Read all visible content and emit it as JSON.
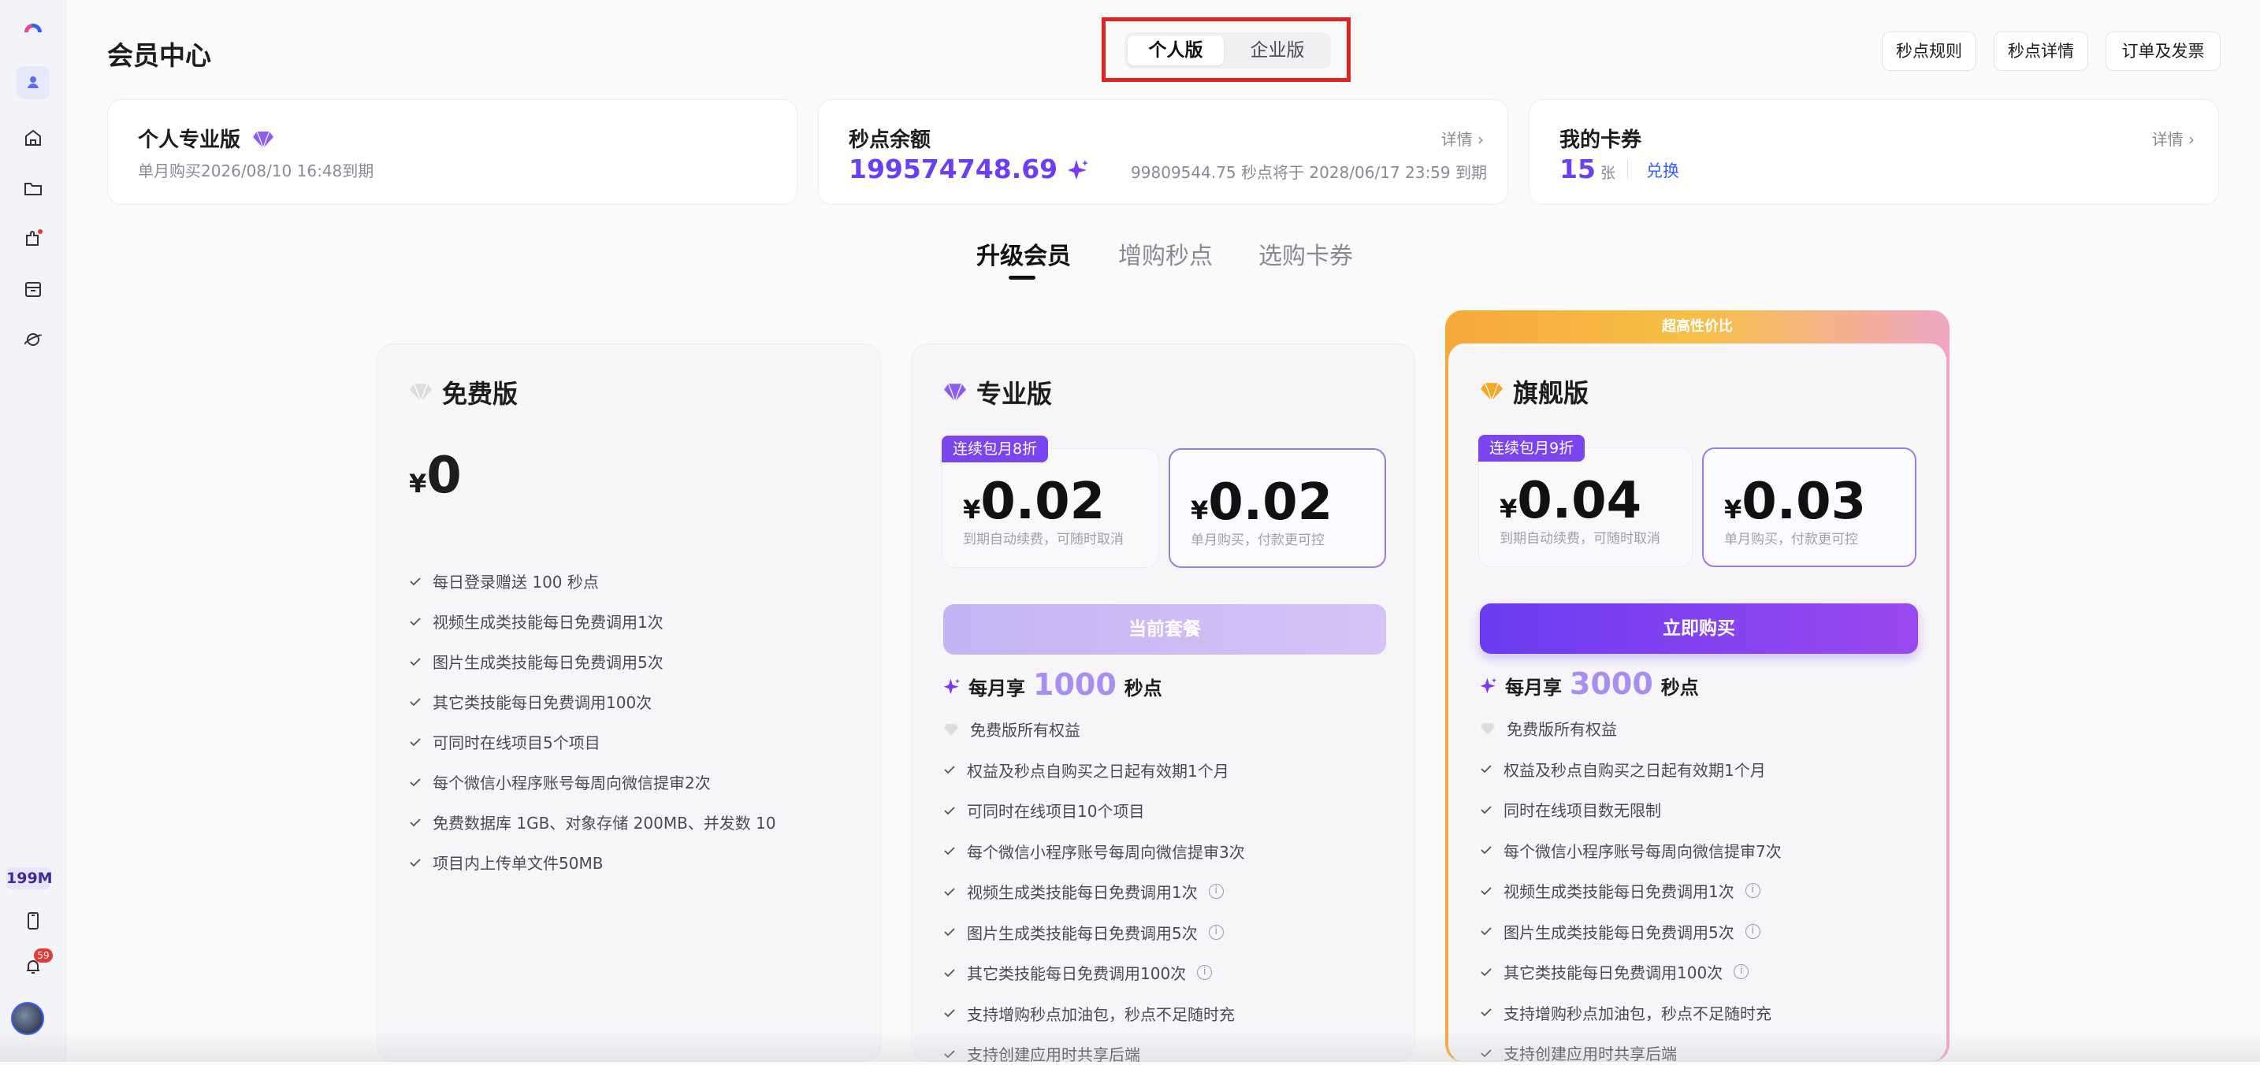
{
  "header": {
    "title": "会员中心",
    "seg_personal": "个人版",
    "seg_enterprise": "企业版",
    "btn_rules": "秒点规则",
    "btn_details": "秒点详情",
    "btn_orders": "订单及发票"
  },
  "sidebar": {
    "balance_badge": "199M",
    "notif_count": "59"
  },
  "cards": {
    "plan": {
      "title": "个人专业版",
      "sub": "单月购买2026/08/10 16:48到期"
    },
    "balance": {
      "title": "秒点余额",
      "value": "199574748.69",
      "detail": "详情",
      "expire": "99809544.75 秒点将于 2028/06/17 23:59 到期"
    },
    "coupon": {
      "title": "我的卡券",
      "count": "15",
      "unit": "张",
      "redeem": "兑换",
      "detail": "详情"
    }
  },
  "tabs": [
    "升级会员",
    "增购秒点",
    "选购卡券"
  ],
  "plans": {
    "free": {
      "name": "免费版",
      "currency": "¥",
      "price": "0",
      "features": [
        "每日登录赠送 100 秒点",
        "视频生成类技能每日免费调用1次",
        "图片生成类技能每日免费调用5次",
        "其它类技能每日免费调用100次",
        "可同时在线项目5个项目",
        "每个微信小程序账号每周向微信提审2次",
        "免费数据库 1GB、对象存储 200MB、并发数 10",
        "项目内上传单文件50MB"
      ]
    },
    "pro": {
      "name": "专业版",
      "badge": "连续包月8折",
      "currency": "¥",
      "price_auto": "0.02",
      "note_auto": "到期自动续费，可随时取消",
      "price_single": "0.02",
      "note_single": "单月购买，付款更可控",
      "cta": "当前套餐",
      "monthly_pre": "每月享",
      "monthly_num": "1000",
      "monthly_post": "秒点",
      "features": [
        "免费版所有权益",
        "权益及秒点自购买之日起有效期1个月",
        "可同时在线项目10个项目",
        "每个微信小程序账号每周向微信提审3次",
        "视频生成类技能每日免费调用1次",
        "图片生成类技能每日免费调用5次",
        "其它类技能每日免费调用100次",
        "支持增购秒点加油包，秒点不足随时充",
        "支持创建应用时共享后端"
      ]
    },
    "flagship": {
      "name": "旗舰版",
      "ribbon": "超高性价比",
      "badge": "连续包月9折",
      "currency": "¥",
      "price_auto": "0.04",
      "note_auto": "到期自动续费，可随时取消",
      "price_single": "0.03",
      "note_single": "单月购买，付款更可控",
      "cta": "立即购买",
      "monthly_pre": "每月享",
      "monthly_num": "3000",
      "monthly_post": "秒点",
      "features": [
        "免费版所有权益",
        "权益及秒点自购买之日起有效期1个月",
        "同时在线项目数无限制",
        "每个微信小程序账号每周向微信提审7次",
        "视频生成类技能每日免费调用1次",
        "图片生成类技能每日免费调用5次",
        "其它类技能每日免费调用100次",
        "支持增购秒点加油包，秒点不足随时充",
        "支持创建应用时共享后端"
      ]
    }
  },
  "icons": [
    "logo-icon",
    "user-icon",
    "home-icon",
    "folder-icon",
    "plugin-icon",
    "box-icon",
    "planet-icon",
    "phone-icon",
    "bell-icon",
    "avatar",
    "chevron-right-icon",
    "sparkle-icon",
    "gem-icon",
    "check-icon",
    "info-icon"
  ],
  "colors": {
    "accent": "#6c3ff0",
    "highlight_border": "#e02424",
    "flagship_ribbon": "#f5a623"
  }
}
